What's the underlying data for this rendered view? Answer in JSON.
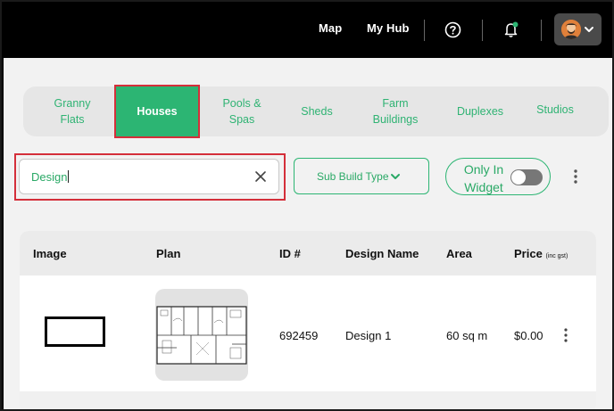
{
  "header": {
    "nav": [
      "Map",
      "My Hub"
    ],
    "icons": [
      "help-icon",
      "bell-icon",
      "avatar",
      "chevron-down-icon"
    ]
  },
  "tabs": [
    {
      "label_line1": "Granny",
      "label_line2": "Flats",
      "active": false
    },
    {
      "label_line1": "Houses",
      "label_line2": "",
      "active": true
    },
    {
      "label_line1": "Pools &",
      "label_line2": "Spas",
      "active": false
    },
    {
      "label_line1": "Sheds",
      "label_line2": "",
      "active": false
    },
    {
      "label_line1": "Farm",
      "label_line2": "Buildings",
      "active": false
    },
    {
      "label_line1": "Duplexes",
      "label_line2": "",
      "active": false
    },
    {
      "label_line1": "Studios",
      "label_line2": "",
      "active": false
    }
  ],
  "filters": {
    "search_value": "Design",
    "sub_build_type_label": "Sub Build Type",
    "widget_toggle_line1": "Only In",
    "widget_toggle_line2": "Widget",
    "widget_toggle_on": false
  },
  "table": {
    "columns": {
      "image": "Image",
      "plan": "Plan",
      "id": "ID #",
      "design_name": "Design Name",
      "area": "Area",
      "price": "Price",
      "price_note": "(inc gst)"
    },
    "rows": [
      {
        "id": "692459",
        "design_name": "Design 1",
        "area": "60 sq m",
        "price": "$0.00"
      }
    ]
  },
  "colors": {
    "accent_green": "#2cb573",
    "highlight_red": "#d42f3a",
    "topbar": "#000000"
  }
}
